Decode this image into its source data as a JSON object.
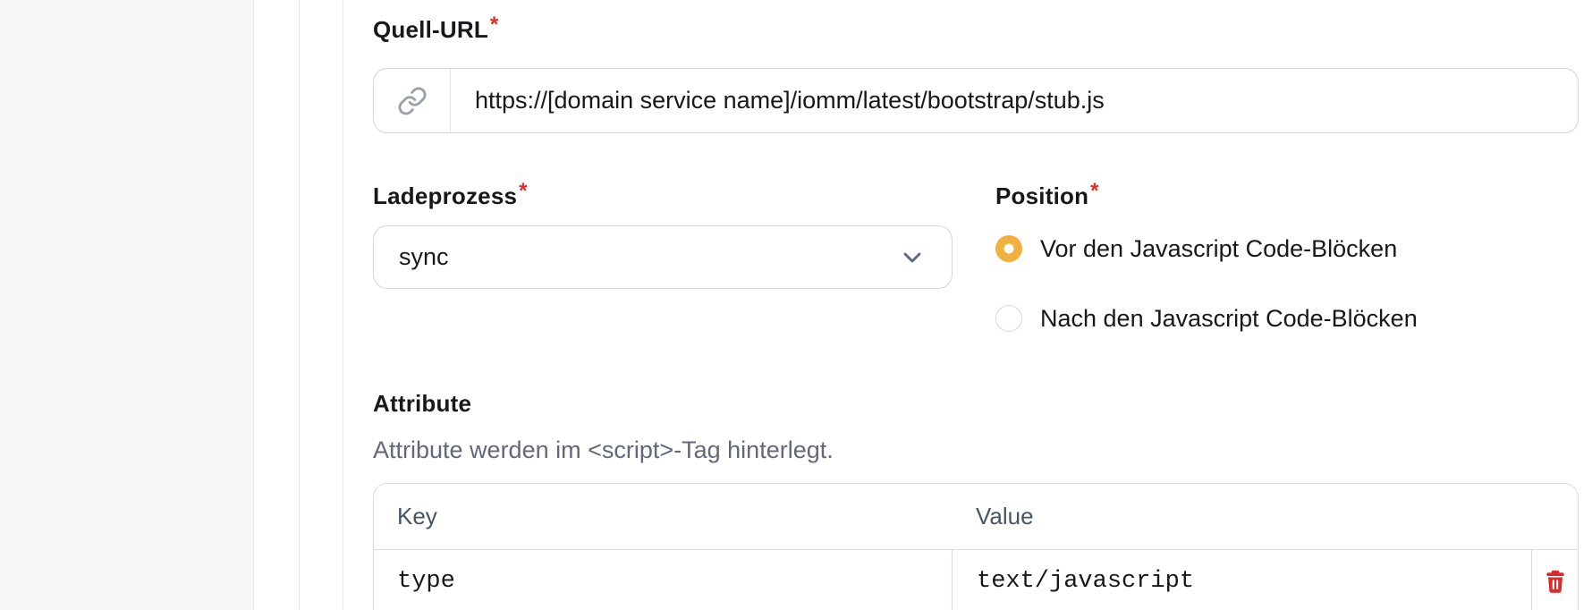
{
  "form": {
    "quell_url": {
      "label": "Quell-URL",
      "required_marker": "*",
      "value": "https://[domain service name]/iomm/latest/bootstrap/stub.js"
    },
    "ladeprozess": {
      "label": "Ladeprozess",
      "required_marker": "*",
      "selected_value": "sync"
    },
    "position": {
      "label": "Position",
      "required_marker": "*",
      "options": [
        {
          "label": "Vor den Javascript Code-Blöcken",
          "selected": true
        },
        {
          "label": "Nach den Javascript Code-Blöcken",
          "selected": false
        }
      ]
    },
    "attributes": {
      "heading": "Attribute",
      "help_text": "Attribute werden im <script>-Tag hinterlegt.",
      "table": {
        "key_header": "Key",
        "value_header": "Value",
        "rows": [
          {
            "key": "type",
            "value": "text/javascript"
          }
        ]
      }
    }
  },
  "icons": {
    "url_prefix": "link-icon",
    "select": "chevron-down-icon",
    "row_action": "trash-icon"
  },
  "colors": {
    "radio_selected": "#f2b03c",
    "danger": "#d92b2b",
    "required_asterisk": "#e02b2b",
    "border": "#d9dbe0",
    "sidebar_bg": "#f8f8f8",
    "help_text": "#62687a"
  }
}
